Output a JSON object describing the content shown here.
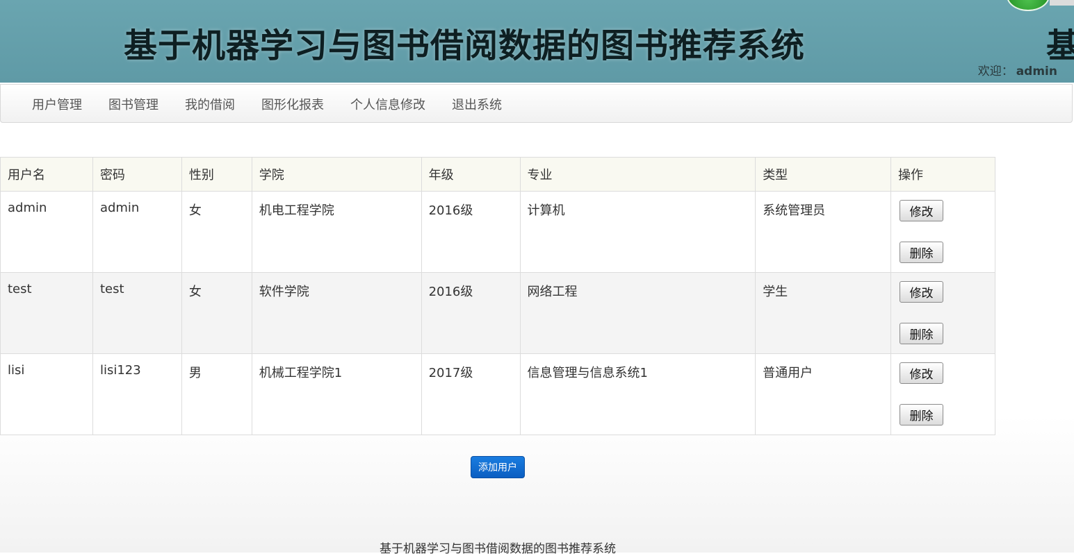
{
  "header": {
    "title": "基于机器学习与图书借阅数据的图书推荐系统",
    "title_ghost": "基",
    "welcome_label": "欢迎：",
    "welcome_user": "admin"
  },
  "nav": {
    "items": [
      {
        "label": "用户管理"
      },
      {
        "label": "图书管理"
      },
      {
        "label": "我的借阅"
      },
      {
        "label": "图形化报表"
      },
      {
        "label": "个人信息修改"
      },
      {
        "label": "退出系统"
      }
    ]
  },
  "table": {
    "headers": [
      "用户名",
      "密码",
      "性别",
      "学院",
      "年级",
      "专业",
      "类型",
      "操作"
    ],
    "rows": [
      {
        "username": "admin",
        "password": "admin",
        "gender": "女",
        "college": "机电工程学院",
        "grade": "2016级",
        "major": "计算机",
        "type": "系统管理员"
      },
      {
        "username": "test",
        "password": "test",
        "gender": "女",
        "college": "软件学院",
        "grade": "2016级",
        "major": "网络工程",
        "type": "学生"
      },
      {
        "username": "lisi",
        "password": "lisi123",
        "gender": "男",
        "college": "机械工程学院1",
        "grade": "2017级",
        "major": "信息管理与信息系统1",
        "type": "普通用户"
      }
    ],
    "edit_label": "修改",
    "delete_label": "删除"
  },
  "add_user_label": "添加用户",
  "footer": {
    "text": "基于机器学习与图书借阅数据的图书推荐系统"
  },
  "colors": {
    "banner": "#6aa5b0",
    "primary_button": "#0b5fc2",
    "header_row": "#f9f9f1"
  }
}
